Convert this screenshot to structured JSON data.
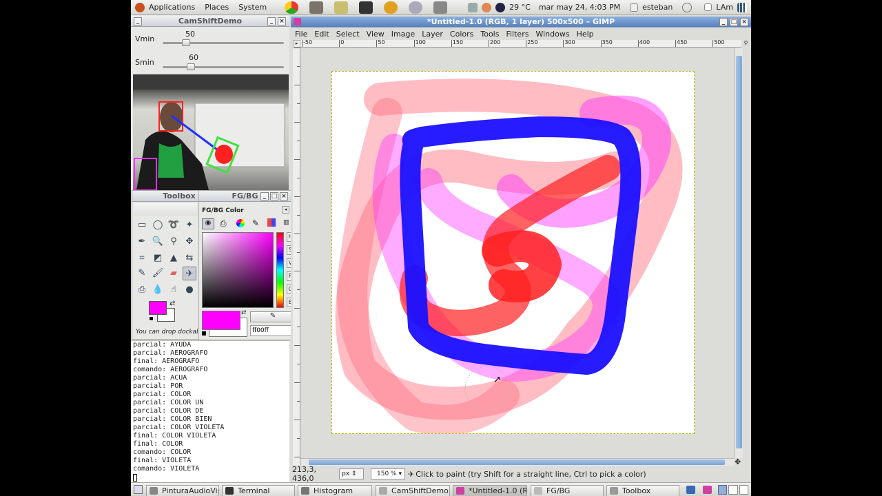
{
  "top_panel": {
    "apps": "Applications",
    "places": "Places",
    "system": "System",
    "weather": "29 °C",
    "datetime": "mar may 24,  4:03 PM",
    "user": "esteban",
    "kbd": "LAm"
  },
  "camshift": {
    "title": "CamShiftDemo",
    "vmin_label": "Vmin",
    "vmin_value": "50",
    "vmin_level": 0.196,
    "smin_label": "Smin",
    "smin_value": "60",
    "smin_level": 0.235
  },
  "console": {
    "lines": [
      "parcial: AYUDA",
      "parcial: AEROGRAFO",
      "final: AEROGRAFO",
      "comando: AEROGRAFO",
      "parcial: ACUA",
      "parcial: POR",
      "parcial: COLOR",
      "parcial: COLOR UN",
      "parcial: COLOR DE",
      "parcial: COLOR BIEN",
      "parcial: COLOR VIOLETA",
      "final: COLOR VIOLETA",
      "final: COLOR",
      "comando: COLOR",
      "final: VIOLETA",
      "comando: VIOLETA"
    ]
  },
  "toolbox": {
    "title": "Toolbox",
    "drop_hint": "You can drop dockable"
  },
  "fgbg": {
    "title": "FG/BG",
    "panel_label": "FG/BG Color",
    "hex_value": "ff00ff",
    "fg_color": "#ff00ff",
    "bg_color": "#ffffff",
    "channels": [
      "H",
      "S",
      "V",
      "R",
      "G",
      "B"
    ]
  },
  "gimp": {
    "title": "*Untitled-1.0 (RGB, 1 layer) 500x500 – GIMP",
    "menu": [
      "File",
      "Edit",
      "Select",
      "View",
      "Image",
      "Layer",
      "Colors",
      "Tools",
      "Filters",
      "Windows",
      "Help"
    ],
    "ruler_ticks": [
      "-50",
      "0",
      "50",
      "100",
      "150",
      "200",
      "250",
      "300",
      "350",
      "400",
      "450",
      "500"
    ],
    "status": {
      "coords": "213,3, 436,0",
      "unit": "px",
      "zoom": "150 %",
      "message": "Click to paint (try Shift for a straight line, Ctrl to pick a color)"
    }
  },
  "taskbar": {
    "items": [
      "PinturaAudioVis...",
      "Terminal",
      "Histogram",
      "CamShiftDemo",
      "*Untitled-1.0 (R...",
      "FG/BG",
      "Toolbox"
    ]
  },
  "colors": {
    "stroke_blue": "#1a10ff",
    "stroke_red": "#ff2020",
    "stroke_pink": "#ff6a7a",
    "stroke_magenta": "#ff2dff",
    "accent": "#5580c0"
  }
}
